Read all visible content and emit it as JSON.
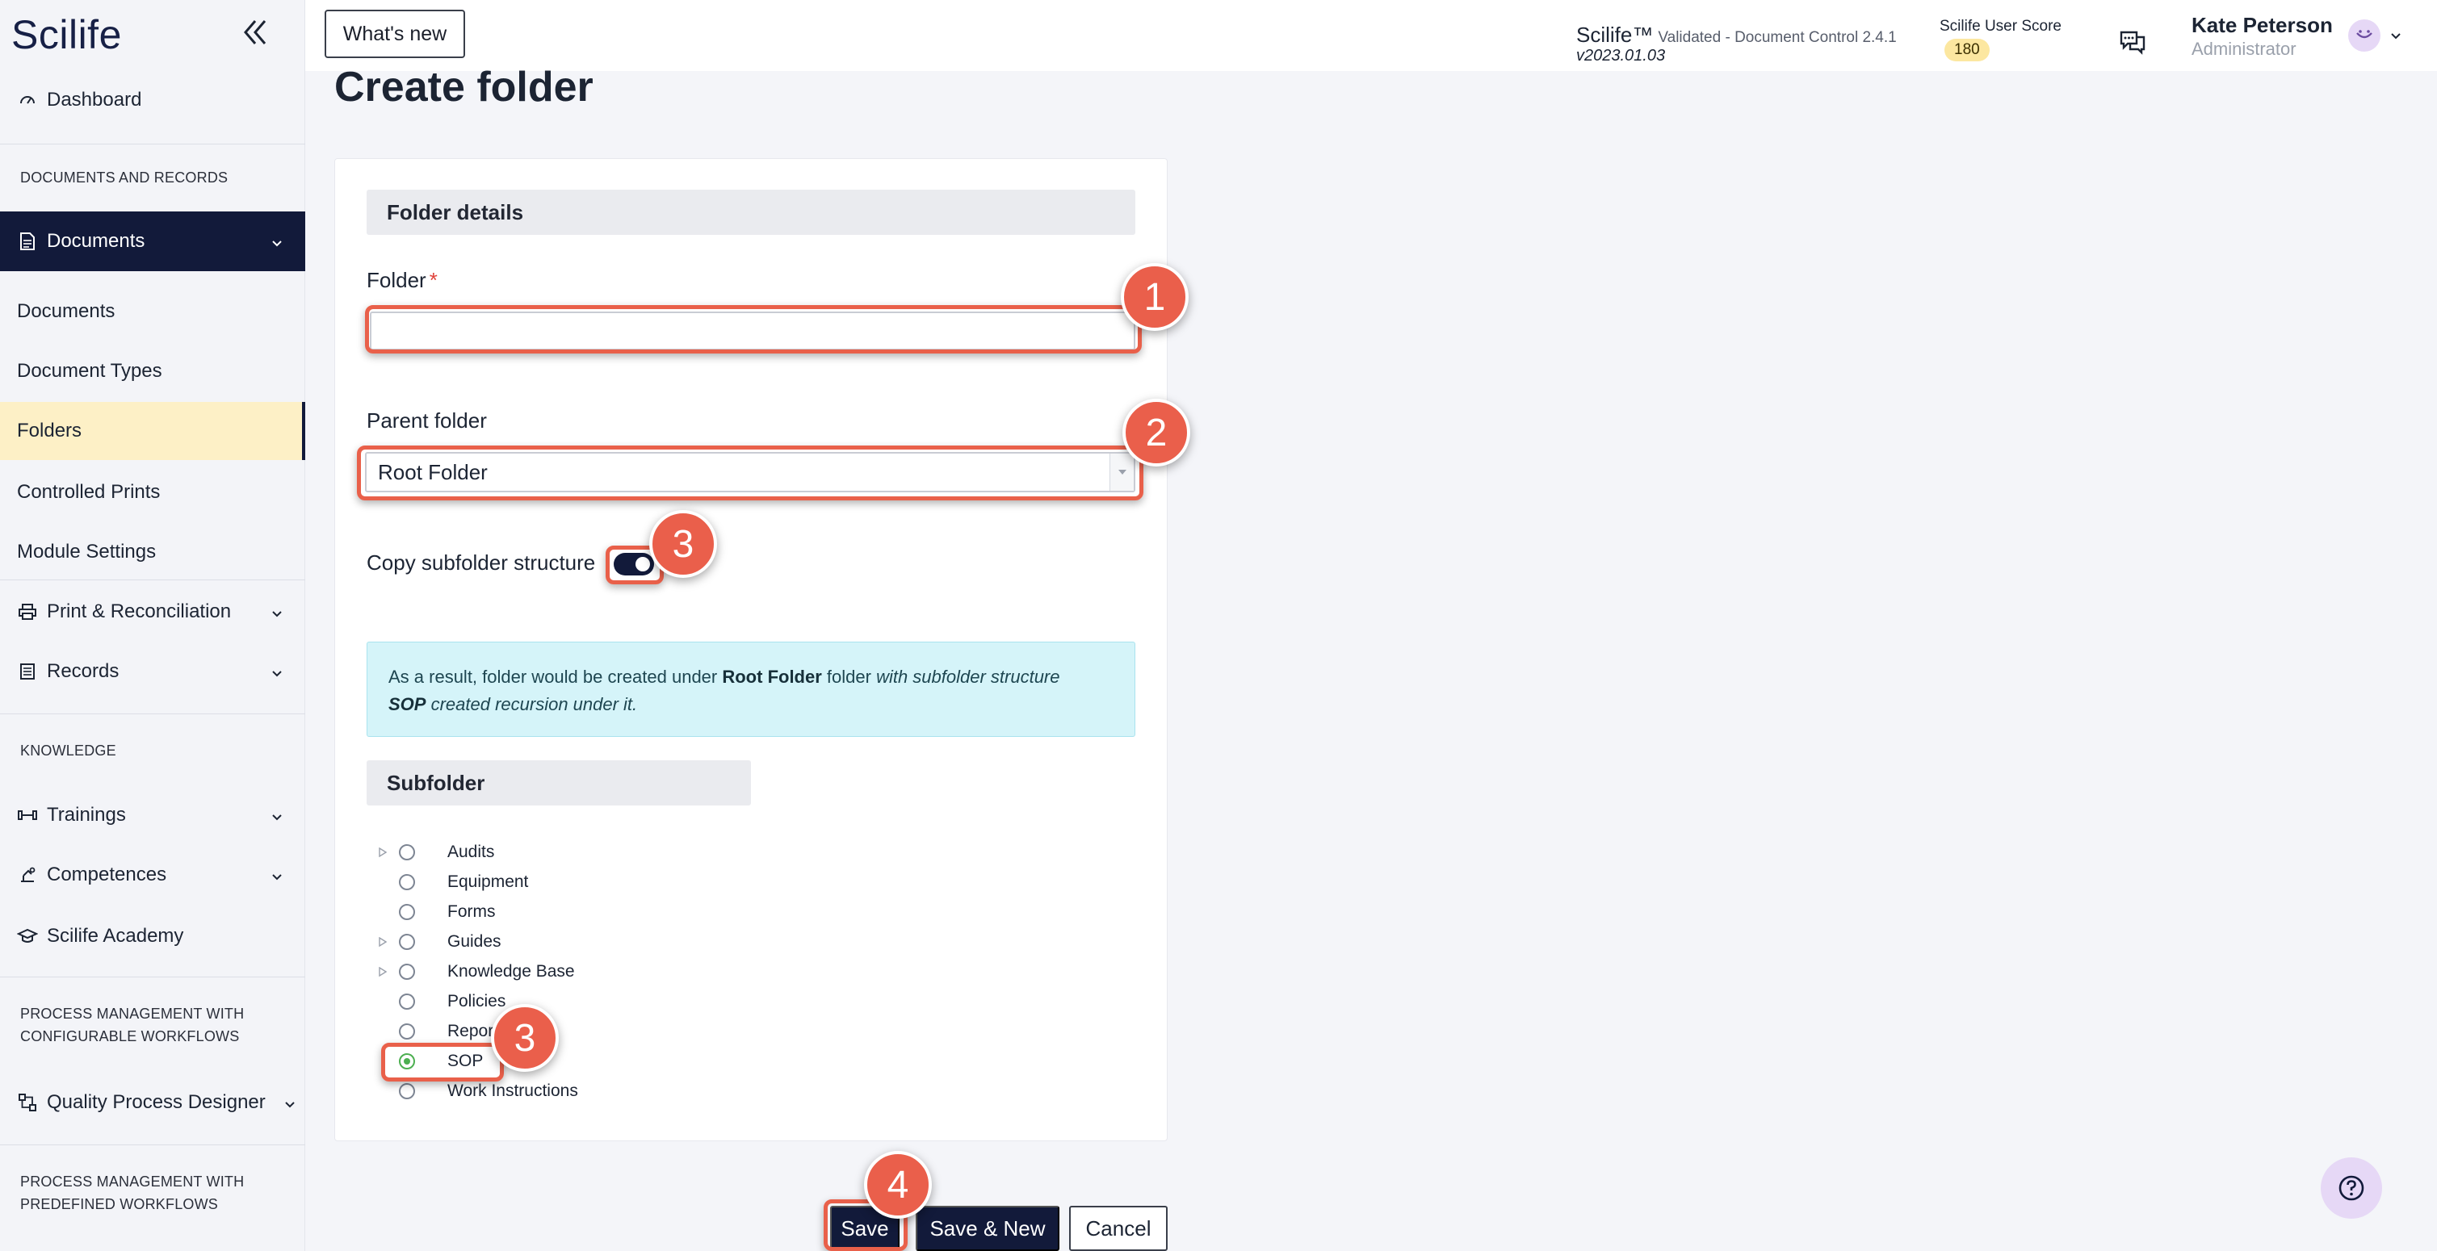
{
  "sidebar": {
    "logo": "Scilife",
    "dashboard": "Dashboard",
    "section_docs": "DOCUMENTS AND RECORDS",
    "documents_group": "Documents",
    "items": {
      "documents": "Documents",
      "document_types": "Document Types",
      "folders": "Folders",
      "controlled_prints": "Controlled Prints",
      "module_settings": "Module Settings"
    },
    "print_reconciliation": "Print & Reconciliation",
    "records": "Records",
    "section_knowledge": "KNOWLEDGE",
    "trainings": "Trainings",
    "competences": "Competences",
    "academy": "Scilife Academy",
    "section_pm_config_1": "PROCESS MANAGEMENT WITH",
    "section_pm_config_2": "CONFIGURABLE WORKFLOWS",
    "quality_process_designer": "Quality Process Designer",
    "section_pm_predef_1": "PROCESS MANAGEMENT WITH",
    "section_pm_predef_2": "PREDEFINED WORKFLOWS"
  },
  "topbar": {
    "whats_new": "What's new",
    "app_name": "Scilife™",
    "app_sub": "Validated - Document Control 2.4.1",
    "version": "v2023.01.03",
    "score_label": "Scilife User Score",
    "score": "180",
    "user_name": "Kate Peterson",
    "user_role": "Administrator"
  },
  "form": {
    "title": "Create folder",
    "details_header": "Folder details",
    "folder_label": "Folder",
    "required_mark": "*",
    "folder_value": "",
    "parent_label": "Parent folder",
    "parent_value": "Root Folder",
    "copy_label": "Copy subfolder structure",
    "copy_enabled": true,
    "info": {
      "p1": "As a result, folder would be created under ",
      "b1": "Root Folder",
      "p2": " folder ",
      "i1": "with subfolder structure",
      "b2": "SOP",
      "i2": " created recursion under it."
    },
    "subfolder_header": "Subfolder",
    "subfolders": [
      {
        "name": "Audits",
        "expandable": true,
        "checked": false
      },
      {
        "name": "Equipment",
        "expandable": false,
        "checked": false
      },
      {
        "name": "Forms",
        "expandable": false,
        "checked": false
      },
      {
        "name": "Guides",
        "expandable": true,
        "checked": false
      },
      {
        "name": "Knowledge Base",
        "expandable": true,
        "checked": false
      },
      {
        "name": "Policies",
        "expandable": false,
        "checked": false
      },
      {
        "name": "Report",
        "expandable": false,
        "checked": false
      },
      {
        "name": "SOP",
        "expandable": false,
        "checked": true
      },
      {
        "name": "Work Instructions",
        "expandable": false,
        "checked": false
      }
    ]
  },
  "buttons": {
    "save": "Save",
    "save_new": "Save & New",
    "cancel": "Cancel"
  },
  "annotations": {
    "m1": "1",
    "m2": "2",
    "m3a": "3",
    "m3b": "3",
    "m4": "4"
  },
  "colors": {
    "primary": "#121a3a",
    "accent": "#ea5f4b",
    "selected": "#fdf0c6",
    "info_bg": "#d5f4f9"
  }
}
